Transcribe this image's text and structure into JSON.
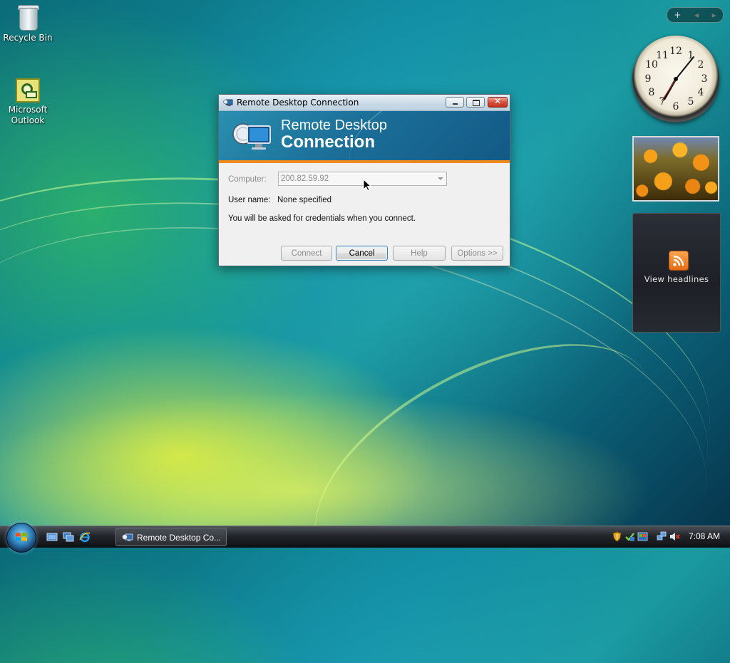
{
  "desktop": {
    "icons": [
      {
        "label": "Recycle Bin",
        "icon": "recycle-bin-icon"
      },
      {
        "label": "Microsoft\nOutlook",
        "label_line1": "Microsoft",
        "label_line2": "Outlook",
        "icon": "outlook-icon"
      }
    ]
  },
  "sidebar": {
    "controls": {
      "add": "+",
      "prev": "◂",
      "next": "▸"
    },
    "clock": {
      "time_shown": "7:08",
      "numerals": [
        "12",
        "1",
        "2",
        "3",
        "4",
        "5",
        "6",
        "7",
        "8",
        "9",
        "10",
        "11"
      ]
    },
    "feed": {
      "label": "View headlines",
      "icon": "rss-icon"
    }
  },
  "dialog": {
    "window_title": "Remote Desktop Connection",
    "banner": {
      "line1": "Remote Desktop",
      "line2": "Connection"
    },
    "computer_label": "Computer:",
    "computer_value": "200.82.59.92",
    "user_label": "User name:",
    "user_value": "None specified",
    "message": "You will be asked for credentials when you connect.",
    "buttons": {
      "connect": "Connect",
      "cancel": "Cancel",
      "help": "Help",
      "options": "Options >>"
    }
  },
  "taskbar": {
    "task_button": "Remote Desktop Co...",
    "time": "7:08 AM"
  },
  "colors": {
    "banner_accent": "#f08a1c",
    "dialog_bg": "#f0f0f0",
    "taskbar_bg": "#22262b"
  }
}
